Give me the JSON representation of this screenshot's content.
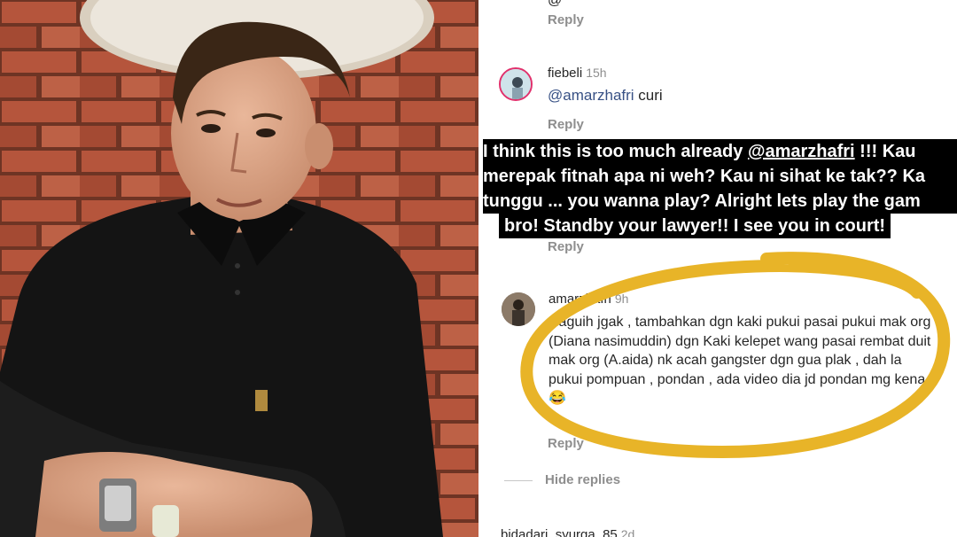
{
  "comments": {
    "top_cut_text": "@",
    "reply_label": "Reply",
    "hide_replies": "Hide replies",
    "c1": {
      "username": "fiebeli",
      "time": "15h",
      "mention": "@amarzhafri",
      "text": " curi"
    },
    "c2": {
      "username": "amarzhafri",
      "time": "9h",
      "text": "Haguih jgak , tambahkan dgn kaki pukui pasai pukui mak org (Diana nasimuddin) dgn Kaki kelepet wang pasai rembat duit mak org (A.aida) nk acah gangster dgn gua plak , dah la pukui pompuan , pondan , ada video dia jd pondan mg kena 😂"
    },
    "c3": {
      "username": "bidadari_syurga_85",
      "time": "2d"
    }
  },
  "overlay": {
    "line1_pre": "I think this is too much already ",
    "line1_mention": "@amarzhafri",
    "line1_post": " !!! Kau",
    "line2": "merepak fitnah apa ni weh? Kau ni sihat ke tak?? Ka",
    "line3": "tunggu ... you wanna play? Alright lets play the gam",
    "line4": "bro! Standby your lawyer!! I see you in court!"
  },
  "colors": {
    "scribble": "#e8b428",
    "overlay_bg": "#000000",
    "overlay_text": "#ffffff"
  }
}
